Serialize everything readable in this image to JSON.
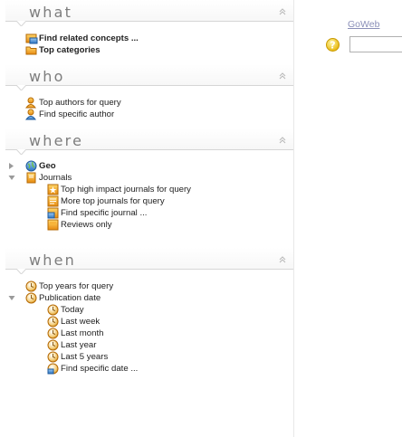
{
  "panels": {
    "what": {
      "title": "what",
      "items": [
        {
          "label": "Find related concepts ..."
        },
        {
          "label": "Top categories"
        }
      ]
    },
    "who": {
      "title": "who",
      "items": [
        {
          "label": "Top authors for query"
        },
        {
          "label": "Find specific author"
        }
      ]
    },
    "where": {
      "title": "where",
      "items": [
        {
          "label": "Geo"
        },
        {
          "label": "Journals"
        },
        {
          "label": "Top high impact journals for query"
        },
        {
          "label": "More top journals for query"
        },
        {
          "label": "Find specific journal ..."
        },
        {
          "label": "Reviews only"
        }
      ]
    },
    "when": {
      "title": "when",
      "items": [
        {
          "label": "Top years for query"
        },
        {
          "label": "Publication date"
        },
        {
          "label": "Today"
        },
        {
          "label": "Last week"
        },
        {
          "label": "Last month"
        },
        {
          "label": "Last year"
        },
        {
          "label": "Last 5 years"
        },
        {
          "label": "Find specific date ..."
        }
      ]
    }
  },
  "main": {
    "goweb_link": "GoWeb",
    "search_value": ""
  }
}
